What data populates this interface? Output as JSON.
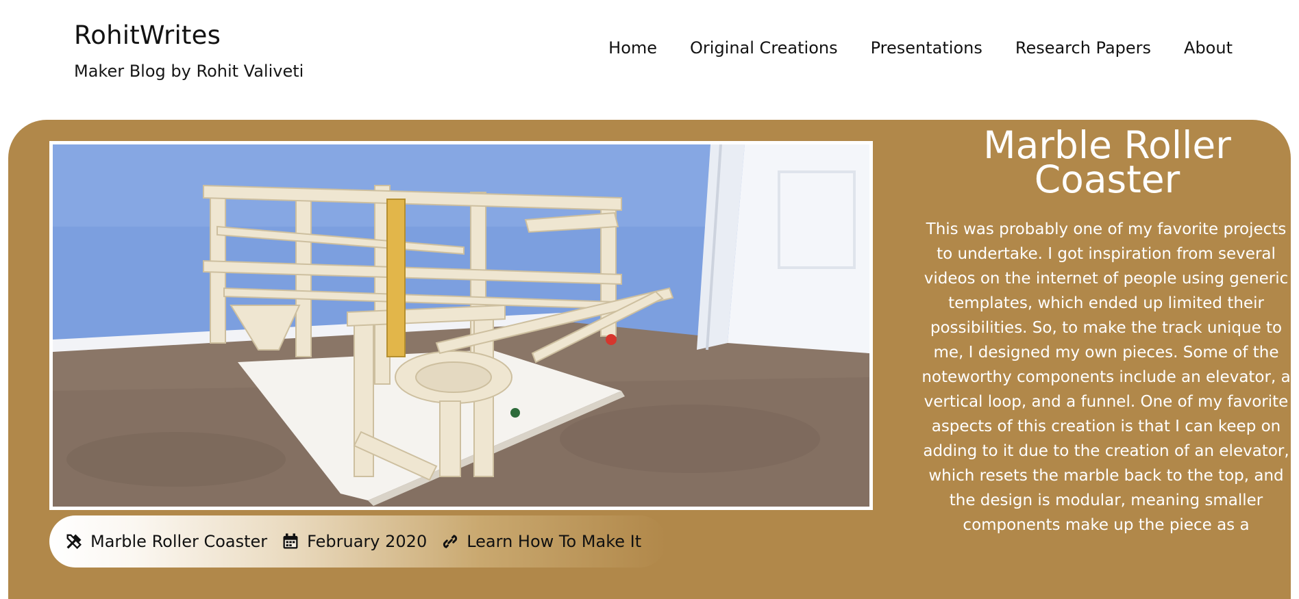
{
  "site": {
    "title": "RohitWrites",
    "tagline": "Maker Blog by Rohit Valiveti"
  },
  "nav": {
    "items": [
      {
        "label": "Home"
      },
      {
        "label": "Original Creations"
      },
      {
        "label": "Presentations"
      },
      {
        "label": "Research Papers"
      },
      {
        "label": "About"
      }
    ]
  },
  "post": {
    "title": "Marble Roller Coaster",
    "body": "This was probably one of my favorite projects to undertake. I got inspiration from several videos on the internet of people using generic templates, which ended up limited their possibilities. So, to make the track unique to me, I designed my own pieces. Some of the noteworthy components include an elevator, a vertical loop, and a funnel. One of my favorite aspects of this creation is that I can keep on adding to it due to the creation of an elevator, which resets the marble back to the top, and the design is modular, meaning smaller components make up the piece as a",
    "meta": {
      "category": "Marble Roller Coaster",
      "date": "February 2020",
      "link_label": "Learn How To Make It"
    }
  },
  "icons": {
    "category": "tools-icon",
    "date": "calendar-icon",
    "link": "link-icon"
  },
  "colors": {
    "accent": "#b1884a",
    "wall": "#7c9fdf",
    "carpet": "#8a7667",
    "door": "#f3f5f8",
    "wood": "#eee6d2"
  }
}
